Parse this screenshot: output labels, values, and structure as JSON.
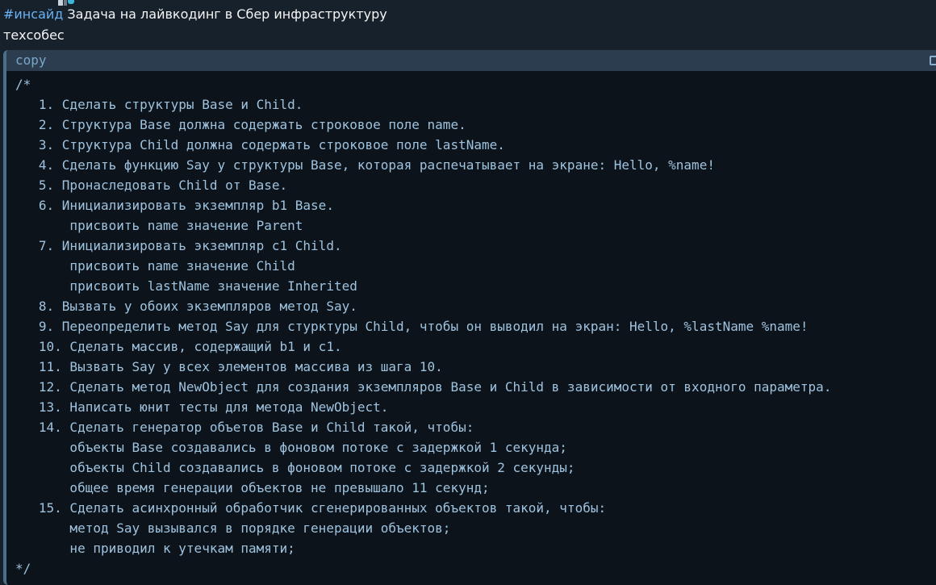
{
  "message": {
    "hashtag": "#инсайд",
    "title": " Задача на лайвкодинг в Сбер инфраструктуру",
    "subtitle": "техсобес"
  },
  "code_block": {
    "language_label": "copy",
    "lines": [
      "/*",
      "   1. Сделать структуры Base и Child.",
      "   2. Структура Base должна содержать строковое поле name.",
      "   3. Структура Child должна содержать строковое поле lastName.",
      "   4. Сделать функцию Say у структуры Base, которая распечатывает на экране: Hello, %name!",
      "   5. Пронаследовать Child от Base.",
      "   6. Инициализировать экземпляр b1 Base.",
      "       присвоить name значение Parent",
      "   7. Инициализировать экземпляр c1 Child.",
      "       присвоить name значение Child",
      "       присвоить lastName значение Inherited",
      "   8. Вызвать у обоих экземпляров метод Say.",
      "   9. Переопределить метод Say для стурктуры Child, чтобы он выводил на экран: Hello, %lastName %name!",
      "   10. Сделать массив, содержащий b1 и c1.",
      "   11. Вызвать Say у всех элементов массива из шага 10.",
      "   12. Сделать метод NewObject для создания экземпляров Base и Child в зависимости от входного параметра.",
      "   13. Написать юнит тесты для метода NewObject.",
      "   14. Сделать генератор объетов Base и Child такой, чтобы:",
      "       объекты Base создавались в фоновом потоке с задержкой 1 секунда;",
      "       объекты Child создавались в фоновом потоке с задержкой 2 секунды;",
      "       общее время генерации объектов не превышало 11 секунд;",
      "   15. Сделать асинхронный обработчик сгенерированных объектов такой, чтобы:",
      "       метод Say вызывался в порядке генерации объектов;",
      "       не приводил к утечкам памяти;",
      "*/"
    ]
  },
  "icons": {
    "copy": "copy-icon"
  },
  "colors": {
    "background": "#17212b",
    "hashtag": "#6ab2f2",
    "code_background": "#0c131a",
    "code_header": "#2b3d4f",
    "code_text": "#9fc3df"
  }
}
